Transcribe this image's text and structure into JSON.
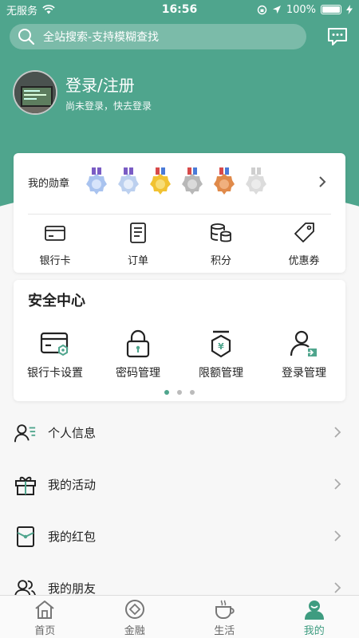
{
  "status_bar": {
    "carrier": "无服务",
    "time": "16:56",
    "battery": "100%"
  },
  "search": {
    "placeholder": "全站搜索-支持模糊查找"
  },
  "profile": {
    "title": "登录/注册",
    "subtitle": "尚未登录，快去登录"
  },
  "medals": {
    "label": "我的勋章",
    "items": [
      {
        "icon": "medal-blue-icon"
      },
      {
        "icon": "medal-lightblue-icon"
      },
      {
        "icon": "medal-gold-icon"
      },
      {
        "icon": "medal-silver-icon"
      },
      {
        "icon": "medal-bronze-icon"
      },
      {
        "icon": "medal-grey-icon"
      }
    ]
  },
  "assets": [
    {
      "label": "银行卡",
      "icon": "bank-card-icon"
    },
    {
      "label": "订单",
      "icon": "order-icon"
    },
    {
      "label": "积分",
      "icon": "points-icon"
    },
    {
      "label": "优惠券",
      "icon": "coupon-icon"
    }
  ],
  "security": {
    "title": "安全中心",
    "items": [
      {
        "label": "银行卡设置",
        "icon": "card-settings-icon"
      },
      {
        "label": "密码管理",
        "icon": "lock-icon"
      },
      {
        "label": "限额管理",
        "icon": "limit-icon"
      },
      {
        "label": "登录管理",
        "icon": "login-manage-icon"
      }
    ],
    "page_count": 3,
    "active_page": 0
  },
  "menu": [
    {
      "label": "个人信息",
      "icon": "user-info-icon"
    },
    {
      "label": "我的活动",
      "icon": "gift-icon"
    },
    {
      "label": "我的红包",
      "icon": "red-packet-icon"
    },
    {
      "label": "我的朋友",
      "icon": "friends-icon"
    }
  ],
  "tabs": [
    {
      "label": "首页",
      "icon": "home-icon"
    },
    {
      "label": "金融",
      "icon": "finance-icon"
    },
    {
      "label": "生活",
      "icon": "life-icon"
    },
    {
      "label": "我的",
      "icon": "profile-icon",
      "active": true
    }
  ],
  "colors": {
    "primary": "#4fa58d",
    "active_tab": "#3e9c80"
  }
}
